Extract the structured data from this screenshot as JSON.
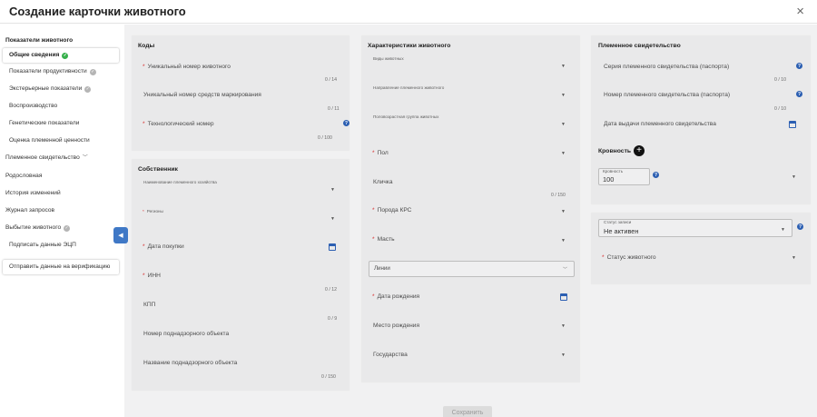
{
  "header": {
    "title": "Создание карточки животного",
    "close_glyph": "×"
  },
  "sidebar": {
    "items": [
      {
        "label": "Показатели животного"
      },
      {
        "label": "Общие сведения"
      },
      {
        "label": "Показатели продуктивности"
      },
      {
        "label": "Экстерьерные показатели"
      },
      {
        "label": "Воспроизводство"
      },
      {
        "label": "Генетические показатели"
      },
      {
        "label": "Оценка племенной ценности"
      },
      {
        "label": "Племенное свидетельство"
      },
      {
        "label": "Родословная"
      },
      {
        "label": "История изменений"
      },
      {
        "label": "Журнал запросов"
      },
      {
        "label": "Выбытие животного"
      },
      {
        "label": "Подписать данные ЭЦП"
      },
      {
        "label": "Отправить данные на верификацию"
      }
    ]
  },
  "codes": {
    "title": "Коды",
    "unique_number": {
      "label": "Уникальный номер животного",
      "counter": "0 / 14"
    },
    "marking_number": {
      "label": "Уникальный номер средств маркирования",
      "counter": "0 / 11"
    },
    "tech_number": {
      "label": "Технологический номер",
      "counter": "0 / 100"
    }
  },
  "owner": {
    "title": "Собственник",
    "farm_name": {
      "label": "Наименование племенного хозяйства"
    },
    "regions": {
      "label": "Регионы"
    },
    "purchase_date": {
      "label": "Дата покупки"
    },
    "inn": {
      "label": "ИНН",
      "counter": "0 / 12"
    },
    "kpp": {
      "label": "КПП",
      "counter": "0 / 9"
    },
    "object_number": {
      "label": "Номер поднадзорного объекта"
    },
    "object_name": {
      "label": "Название поднадзорного объекта",
      "counter": "0 / 150"
    }
  },
  "characteristics": {
    "title": "Характеристики животного",
    "species": {
      "label": "Виды животных"
    },
    "direction": {
      "label": "Направление племенного животного"
    },
    "sex_age_group": {
      "label": "Половозрастная группа животных"
    },
    "sex": {
      "label": "Пол"
    },
    "nickname": {
      "label": "Кличка",
      "counter": "0 / 150"
    },
    "breed": {
      "label": "Порода КРС"
    },
    "color": {
      "label": "Масть"
    },
    "lines": {
      "label": "Линии"
    },
    "birth_date": {
      "label": "Дата рождения"
    },
    "birth_place": {
      "label": "Место рождения"
    },
    "country": {
      "label": "Государства"
    }
  },
  "certificate": {
    "title": "Племенное свидетельство",
    "series": {
      "label": "Серия племенного свидетельства (паспорта)",
      "counter": "0 / 10"
    },
    "number": {
      "label": "Номер племенного свидетельства (паспорта)",
      "counter": "0 / 10"
    },
    "issue_date": {
      "label": "Дата выдачи племенного свидетельства"
    },
    "blood": {
      "title": "Кровность",
      "field_label": "Кровность",
      "value": "100"
    }
  },
  "status": {
    "record_status": {
      "label": "Статус записи",
      "value": "Не активен"
    },
    "animal_status": {
      "label": "Статус животного"
    }
  },
  "footer": {
    "save_label": "Сохранить"
  },
  "colors": {
    "accent": "#2c5fb2",
    "required": "#d82a2a",
    "ok": "#36b04b",
    "collapse": "#3f78c6"
  }
}
